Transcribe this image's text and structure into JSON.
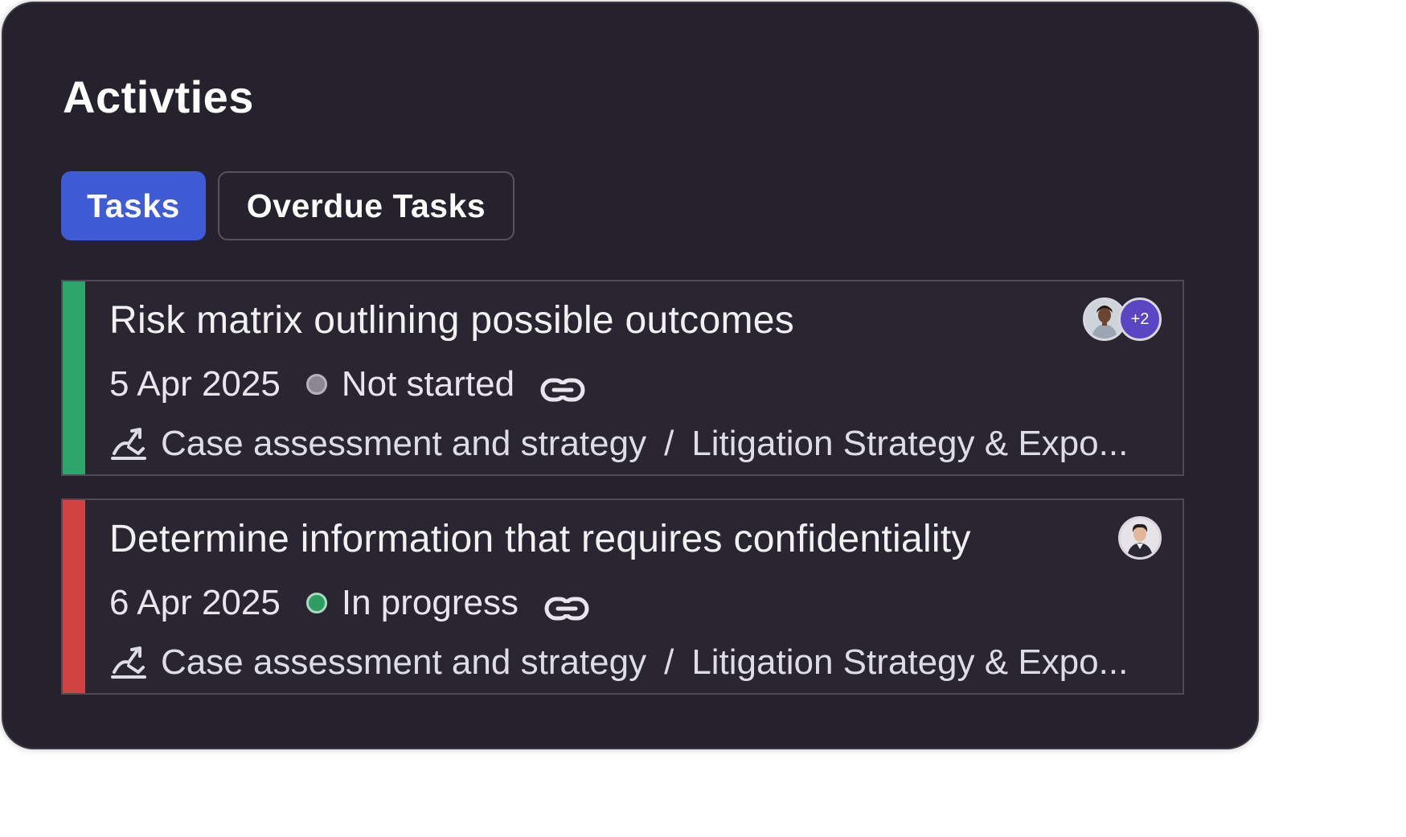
{
  "title": "Activties",
  "tabs": [
    {
      "label": "Tasks",
      "active": true
    },
    {
      "label": "Overdue Tasks",
      "active": false
    }
  ],
  "tasks": [
    {
      "title": "Risk matrix outlining possible outcomes",
      "date": "5 Apr 2025",
      "status": "Not started",
      "status_color": "#8a8790",
      "stripe_color": "#2ea56a",
      "path_left": "Case assessment and strategy",
      "separator": "/",
      "path_right": "Litigation Strategy & Expo...",
      "avatar_more": "+2"
    },
    {
      "title": "Determine information that requires confidentiality",
      "date": "6 Apr 2025",
      "status": "In progress",
      "status_color": "#2e9d63",
      "stripe_color": "#d04340",
      "path_left": "Case assessment and strategy",
      "separator": "/",
      "path_right": "Litigation Strategy & Expo..."
    }
  ],
  "icons": {
    "link": "link-icon",
    "path": "workflow-icon"
  },
  "colors": {
    "panel_bg": "#26222d",
    "active_tab": "#3f5cd6",
    "more_badge": "#5a45c2"
  }
}
